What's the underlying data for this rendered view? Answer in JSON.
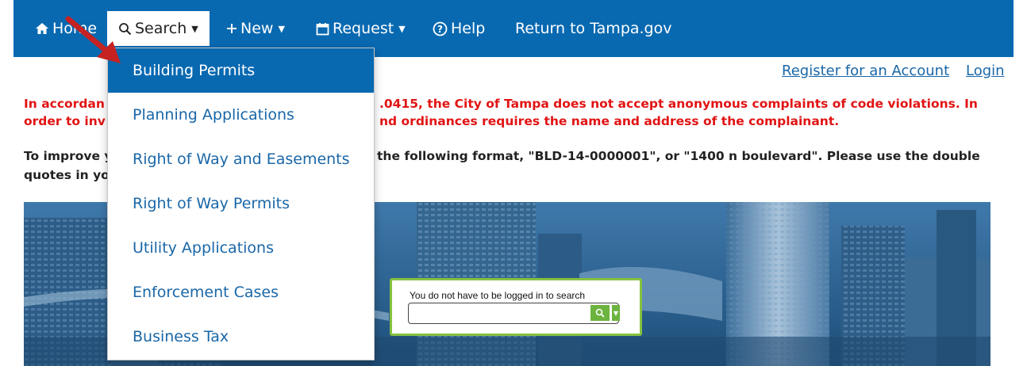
{
  "nav": {
    "home": "Home",
    "search": "Search",
    "new": "New",
    "request": "Request",
    "help": "Help",
    "return": "Return to Tampa.gov"
  },
  "auth": {
    "register": "Register for an Account",
    "login": "Login"
  },
  "notice": {
    "line1_left": "In accordan",
    "line1_right": ".0415, the City of Tampa does not accept anonymous complaints of code violations.  In",
    "line2_left": "order to inv",
    "line2_right": "nd ordinances requires the name and address of the complainant."
  },
  "tip": {
    "line1_left": "To improve y",
    "line1_right": "the following format, \"BLD-14-0000001\", or \"1400 n boulevard\". Please use the double",
    "line2_left": "quotes in yo"
  },
  "search_widget": {
    "label": "You do not have to be logged in to search",
    "value": ""
  },
  "search_menu": {
    "items": [
      {
        "label": "Building Permits"
      },
      {
        "label": "Planning Applications"
      },
      {
        "label": "Right of Way and Easements"
      },
      {
        "label": "Right of Way Permits"
      },
      {
        "label": "Utility Applications"
      },
      {
        "label": "Enforcement Cases"
      },
      {
        "label": "Business Tax"
      }
    ],
    "highlighted_index": 0
  },
  "colors": {
    "navbar": "#0869b1",
    "notice_red": "#e11414",
    "link_blue": "#1a67a8",
    "search_green": "#6cb33f",
    "pointer_arrow": "#c62222"
  },
  "icons": {
    "home": "home-icon",
    "search": "search-icon",
    "new": "plus-icon",
    "request": "calendar-icon",
    "help": "help-circle-icon",
    "pointer": "red-arrow-pointer"
  }
}
